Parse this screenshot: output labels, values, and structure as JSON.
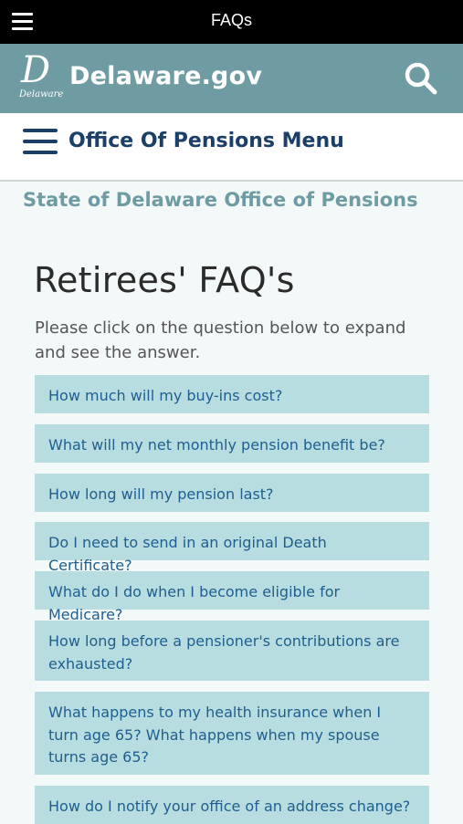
{
  "topbar": {
    "title": "FAQs"
  },
  "site": {
    "logo_text": "Delaware",
    "name": "Delaware.gov"
  },
  "menu": {
    "label": "Office Of Pensions Menu"
  },
  "office": {
    "title": "State of Delaware Office of Pensions"
  },
  "page": {
    "heading": "Retirees' FAQ's",
    "intro": "Please click on the question below to expand and see the answer."
  },
  "faqs": [
    {
      "question": "How much will my buy-ins cost?"
    },
    {
      "question": "What will my net monthly pension benefit be?"
    },
    {
      "question": "How long will my pension last?"
    },
    {
      "question": "Do I need to send in an original Death Certificate?"
    },
    {
      "question": "What do I do when I become eligible for Medicare?"
    },
    {
      "question": "How long before a pensioner's contributions are exhausted?"
    },
    {
      "question": "What happens to my health insurance when I turn age 65? What happens when my spouse turns age 65?"
    },
    {
      "question": "How do I notify your office of an address change?"
    }
  ],
  "colors": {
    "topbar": "#000000",
    "sitebar": "#6f9ba2",
    "menu_text": "#1b3f66",
    "faq_bg": "#b8dde0",
    "faq_text": "#1f5e8f"
  },
  "icons": {
    "topbar_menu": "hamburger-icon",
    "search": "search-icon",
    "section_menu": "hamburger-icon"
  }
}
